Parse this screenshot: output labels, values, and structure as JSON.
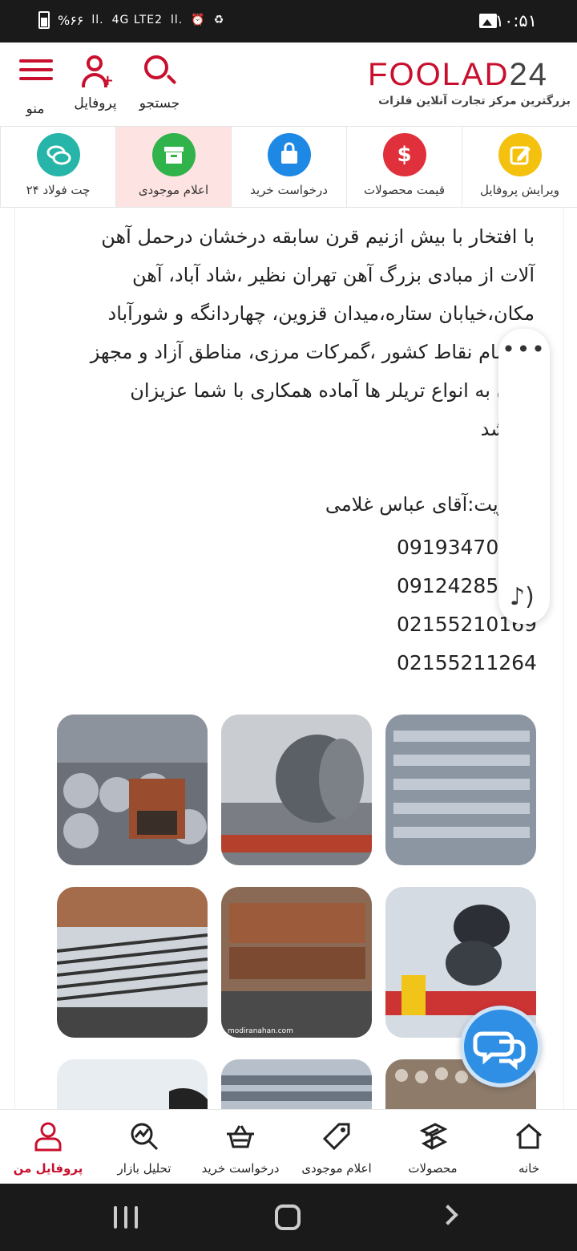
{
  "status_bar": {
    "time": "۱۰:۵۱",
    "battery": "%۶۶",
    "network": "4G LTE2"
  },
  "header": {
    "logo_text": "FOOLAD",
    "logo_number": "24",
    "tagline": "بزرگترین مرکز تجارت آنلاین فلزات",
    "search_label": "جستجو",
    "profile_label": "پروفایل",
    "menu_label": "منو"
  },
  "tiles": [
    {
      "label": "ویرایش پروفایل",
      "icon": "edit-icon",
      "color": "#f4c10f"
    },
    {
      "label": "قیمت محصولات",
      "icon": "dollar-icon",
      "color": "#e0303b"
    },
    {
      "label": "درخواست خرید",
      "icon": "shopping-bag-icon",
      "color": "#1e88e5"
    },
    {
      "label": "اعلام موجودی",
      "icon": "archive-icon",
      "color": "#2fb34a"
    },
    {
      "label": "چت فولاد ۲۴",
      "icon": "chat-icon",
      "color": "#26b5a8"
    }
  ],
  "content": {
    "paragraph_lines": [
      "با افتخار با بیش ازنیم قرن سابقه درخشان درحمل آهن",
      "آلات از مبادی بزرگ آهن تهران نظیر ،شاد آباد، آهن",
      "مکان،خیابان ستاره،میدان قزوین، چهاردانگه و شورآباد",
      "به تمام نقاط کشور ،گمرکات مرزی، مناطق آزاد و مجهز",
      "بودن به انواع تریلر ها آماده همکاری با شما عزیزان",
      "میباشد"
    ],
    "manager": "مدیریت:آقای عباس غلامی",
    "phones": [
      "09193470133",
      "09124285800",
      "02155210169",
      "02155211264"
    ],
    "photo_watermark": "modiranahan.com"
  },
  "bottom_nav": [
    {
      "label": "خانه",
      "icon": "home-icon"
    },
    {
      "label": "محصولات",
      "icon": "steel-beam-icon"
    },
    {
      "label": "اعلام موجودی",
      "icon": "tag-icon"
    },
    {
      "label": "درخواست خرید",
      "icon": "basket-icon"
    },
    {
      "label": "تحلیل بازار",
      "icon": "market-analysis-icon"
    },
    {
      "label": "پروفایل من",
      "icon": "user-icon",
      "active": true
    }
  ],
  "colors": {
    "brand": "#c8102e",
    "chat_fab": "#2f8fe5",
    "active_tile_bg": "#fde3e1"
  }
}
